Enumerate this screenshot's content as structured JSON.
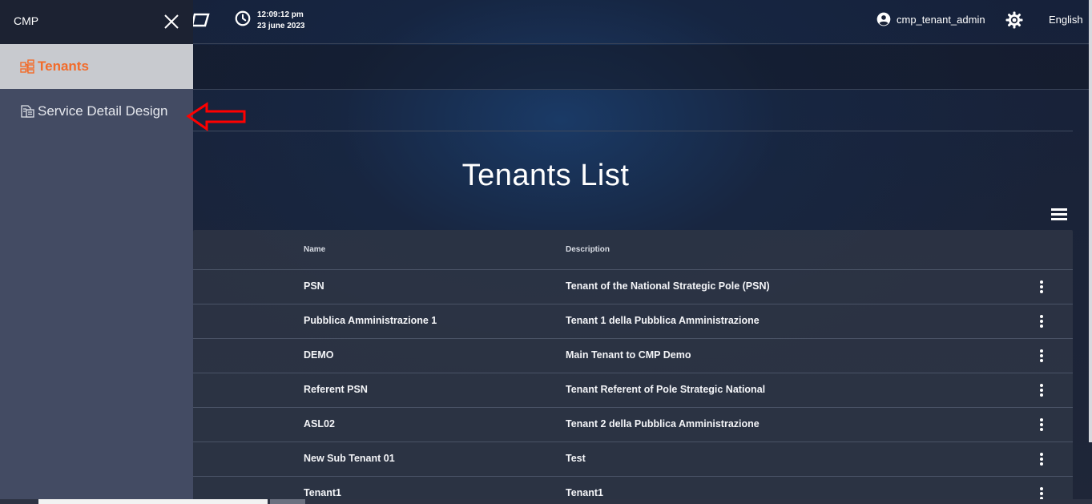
{
  "app": {
    "clock_time": "12:09:12 pm",
    "clock_date": "23 june 2023",
    "username": "cmp_tenant_admin",
    "language": "English"
  },
  "sidebar": {
    "title": "CMP",
    "items": [
      {
        "label": "Tenants",
        "icon": "tenants-icon",
        "active": true
      },
      {
        "label": "Service Detail Design",
        "icon": "document-icon",
        "active": false
      }
    ]
  },
  "page": {
    "title": "Tenants List"
  },
  "table": {
    "columns": [
      "Name",
      "Description"
    ],
    "rows": [
      {
        "name": "PSN",
        "description": "Tenant of the National Strategic Pole (PSN)"
      },
      {
        "name": "Pubblica Amministrazione 1",
        "description": "Tenant 1 della Pubblica Amministrazione"
      },
      {
        "name": "DEMO",
        "description": "Main Tenant to CMP Demo"
      },
      {
        "name": "Referent PSN",
        "description": "Tenant Referent of Pole Strategic National"
      },
      {
        "name": "ASL02",
        "description": "Tenant 2 della Pubblica Amministrazione"
      },
      {
        "name": "New Sub Tenant 01",
        "description": "Test"
      },
      {
        "name": "Tenant1",
        "description": "Tenant1"
      }
    ]
  },
  "colors": {
    "accent": "#f26b2a",
    "annotation_arrow": "#ff0000",
    "sidebar_bg": "#434b63",
    "sidebar_active_bg": "#c8cacf"
  }
}
